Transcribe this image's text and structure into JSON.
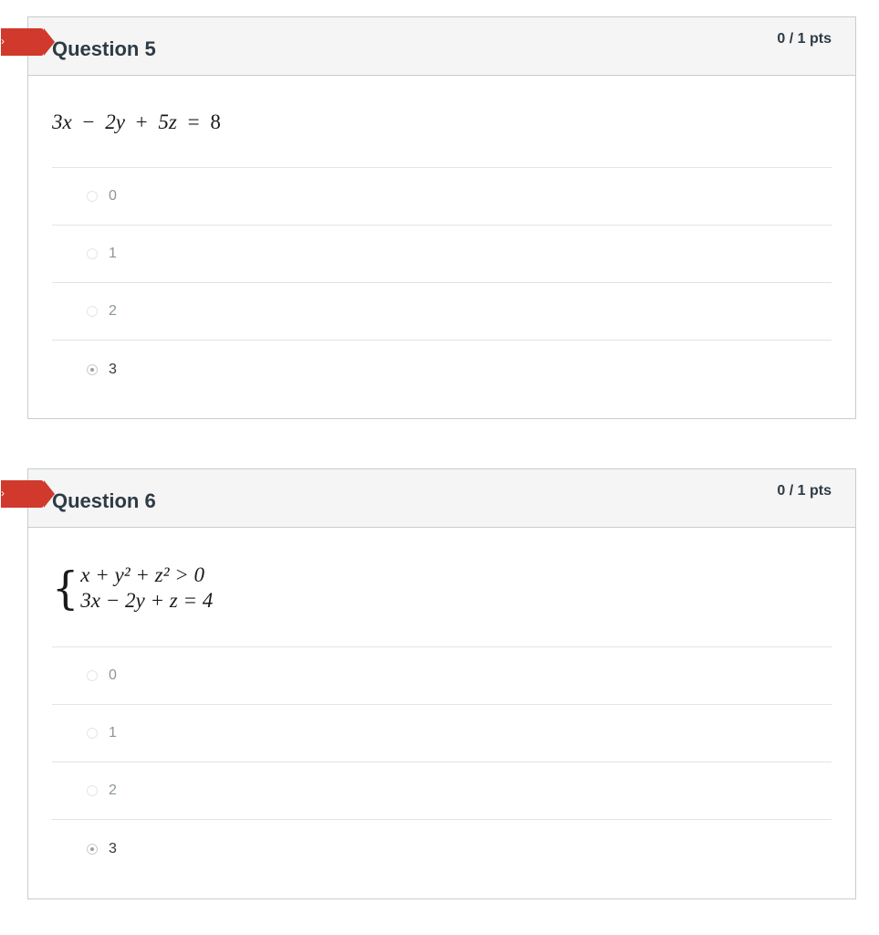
{
  "questions": [
    {
      "title": "Question 5",
      "points": "0 / 1 pts",
      "equation": {
        "a": "3x",
        "op1": "−",
        "b": "2y",
        "op2": "+",
        "c": "5z",
        "eq": "=",
        "rhs": "8"
      },
      "answers": [
        {
          "label": "0",
          "selected": false
        },
        {
          "label": "1",
          "selected": false
        },
        {
          "label": "2",
          "selected": false
        },
        {
          "label": "3",
          "selected": true
        }
      ]
    },
    {
      "title": "Question 6",
      "points": "0 / 1 pts",
      "system": {
        "line1": "x + y² + z² > 0",
        "line2": "3x − 2y + z = 4"
      },
      "answers": [
        {
          "label": "0",
          "selected": false
        },
        {
          "label": "1",
          "selected": false
        },
        {
          "label": "2",
          "selected": false
        },
        {
          "label": "3",
          "selected": true
        }
      ]
    }
  ],
  "colors": {
    "flag": "#d0392b",
    "header_bg": "#f5f5f5",
    "border": "#c7cdd1",
    "title_text": "#2d3b45"
  },
  "icons": {
    "flag": "incorrect-flag-icon"
  }
}
